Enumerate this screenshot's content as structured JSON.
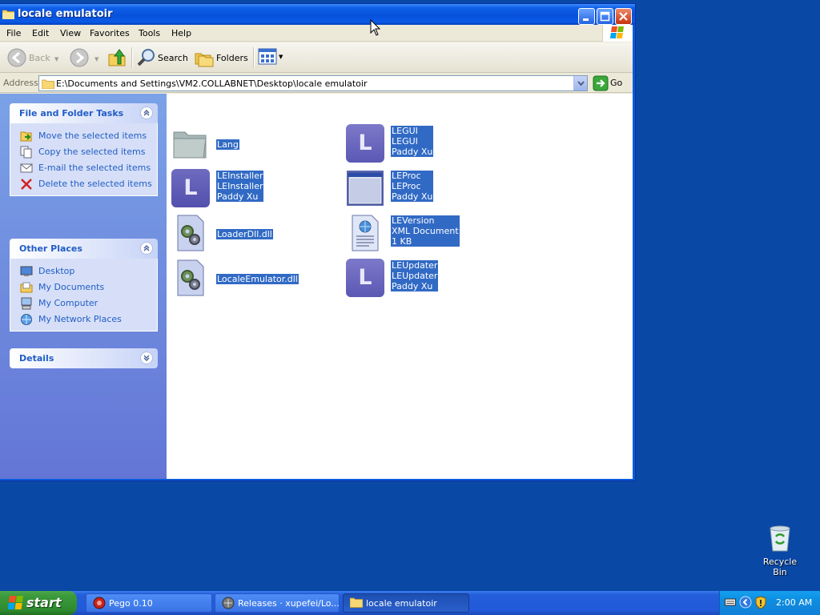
{
  "window": {
    "title": "locale emulatoir"
  },
  "menu": [
    "File",
    "Edit",
    "View",
    "Favorites",
    "Tools",
    "Help"
  ],
  "toolbar": {
    "back": "Back",
    "search": "Search",
    "folders": "Folders"
  },
  "address": {
    "label": "Address",
    "path": "E:\\Documents and Settings\\VM2.COLLABNET\\Desktop\\locale emulatoir",
    "go": "Go"
  },
  "taskpane": {
    "file_tasks": {
      "title": "File and Folder Tasks",
      "items": [
        {
          "label": "Move the selected items",
          "icon": "move-icon"
        },
        {
          "label": "Copy the selected items",
          "icon": "copy-icon"
        },
        {
          "label": "E-mail the selected items",
          "icon": "email-icon"
        },
        {
          "label": "Delete the selected items",
          "icon": "delete-icon"
        }
      ]
    },
    "other_places": {
      "title": "Other Places",
      "items": [
        {
          "label": "Desktop",
          "icon": "desktop-icon"
        },
        {
          "label": "My Documents",
          "icon": "my-documents-icon"
        },
        {
          "label": "My Computer",
          "icon": "my-computer-icon"
        },
        {
          "label": "My Network Places",
          "icon": "network-places-icon"
        }
      ]
    },
    "details": {
      "title": "Details"
    }
  },
  "files": [
    {
      "lines": [
        "Lang"
      ],
      "icon": "folder-icon"
    },
    {
      "lines": [
        "LEGUI",
        "LEGUI",
        "Paddy Xu"
      ],
      "icon": "app-l-icon"
    },
    {
      "lines": [
        "LEInstaller",
        "LEInstaller",
        "Paddy Xu"
      ],
      "icon": "app-l-icon"
    },
    {
      "lines": [
        "LEProc",
        "LEProc",
        "Paddy Xu"
      ],
      "icon": "window-app-icon"
    },
    {
      "lines": [
        "LoaderDll.dll"
      ],
      "icon": "dll-icon"
    },
    {
      "lines": [
        "LEVersion",
        "XML Document",
        "1 KB"
      ],
      "icon": "xml-document-icon"
    },
    {
      "lines": [
        "LocaleEmulator.dll"
      ],
      "icon": "dll-icon"
    },
    {
      "lines": [
        "LEUpdater",
        "LEUpdater",
        "Paddy Xu"
      ],
      "icon": "app-l-icon"
    }
  ],
  "desktop": {
    "recycle_bin": "Recycle Bin"
  },
  "taskbar": {
    "start": "start",
    "buttons": [
      {
        "label": "Pego 0.10",
        "icon": "pego-icon"
      },
      {
        "label": "Releases · xupefei/Lo...",
        "icon": "browser-icon"
      },
      {
        "label": "locale emulatoir",
        "icon": "folder-icon"
      }
    ],
    "clock": "2:00 AM"
  },
  "colors": {
    "selection": "#316ac5",
    "titlebar": "#0851db",
    "taskpane_link": "#215dc6",
    "desktop": "#0a48a6"
  }
}
